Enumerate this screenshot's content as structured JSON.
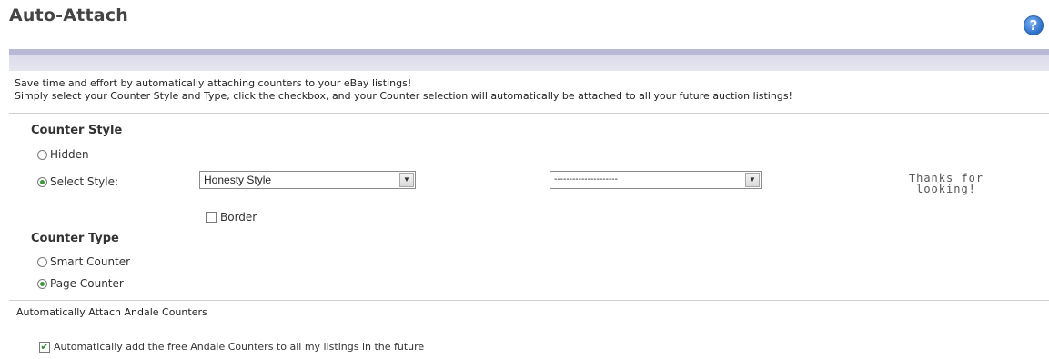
{
  "header": {
    "title": "Auto-Attach",
    "help_icon": "question-mark-icon"
  },
  "intro": {
    "line1": "Save time and effort by automatically attaching counters to your eBay listings!",
    "line2": "Simply select your Counter Style and Type, click the checkbox, and your Counter selection will automatically be attached to all your future auction listings!"
  },
  "counter_style": {
    "heading": "Counter Style",
    "hidden_label": "Hidden",
    "select_label": "Select Style:",
    "selected_option": "select-style",
    "style_dropdown": {
      "value": "Honesty Style"
    },
    "variant_dropdown": {
      "value": "---------------------"
    },
    "border_label": "Border",
    "border_checked": false,
    "preview_line1": "Thanks for",
    "preview_line2": "looking!"
  },
  "counter_type": {
    "heading": "Counter Type",
    "smart_label": "Smart Counter",
    "page_label": "Page Counter",
    "selected_option": "page-counter"
  },
  "auto_attach": {
    "heading": "Automatically Attach Andale Counters",
    "checkbox_label": "Automatically add the free Andale Counters to all my listings in the future",
    "checked": true
  },
  "colors": {
    "banner": "#b9b9d6",
    "checked_green": "#3b9a3b",
    "help_blue": "#2a6fc9"
  }
}
